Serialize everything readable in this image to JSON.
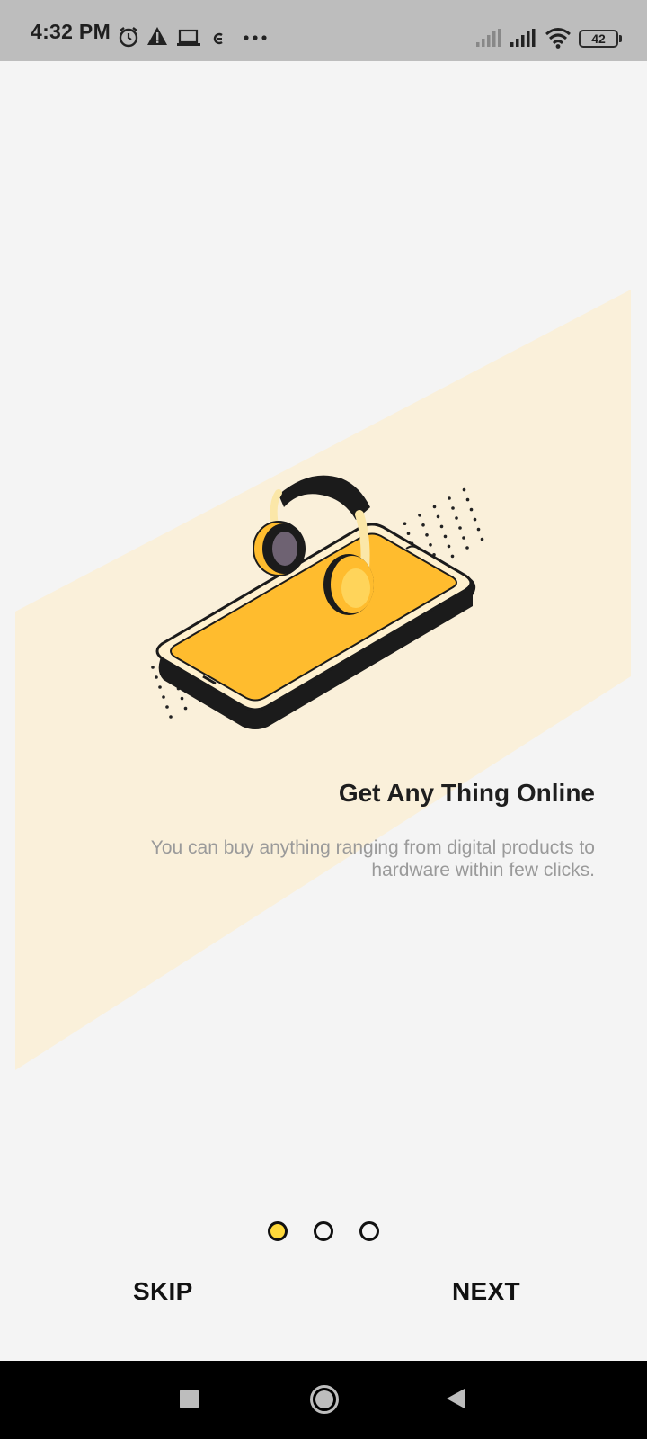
{
  "status_bar": {
    "time": "4:32 PM",
    "battery": "42",
    "icons": [
      "alarm-icon",
      "warning-icon",
      "laptop-icon",
      "app-notification-icon",
      "more-icon",
      "signal-icon",
      "signal-icon",
      "wifi-icon",
      "battery-icon"
    ]
  },
  "onboarding": {
    "title": "Get Any Thing Online",
    "description": "You can buy anything ranging from digital products to hardware within few clicks.",
    "current_page": 1,
    "total_pages": 3
  },
  "actions": {
    "skip_label": "SKIP",
    "next_label": "NEXT"
  },
  "colors": {
    "accent": "#FFBC2E",
    "band": "#FAF0DA",
    "background": "#F4F4F4"
  },
  "system_nav": {
    "icons": [
      "recents-icon",
      "home-icon",
      "back-icon"
    ]
  }
}
